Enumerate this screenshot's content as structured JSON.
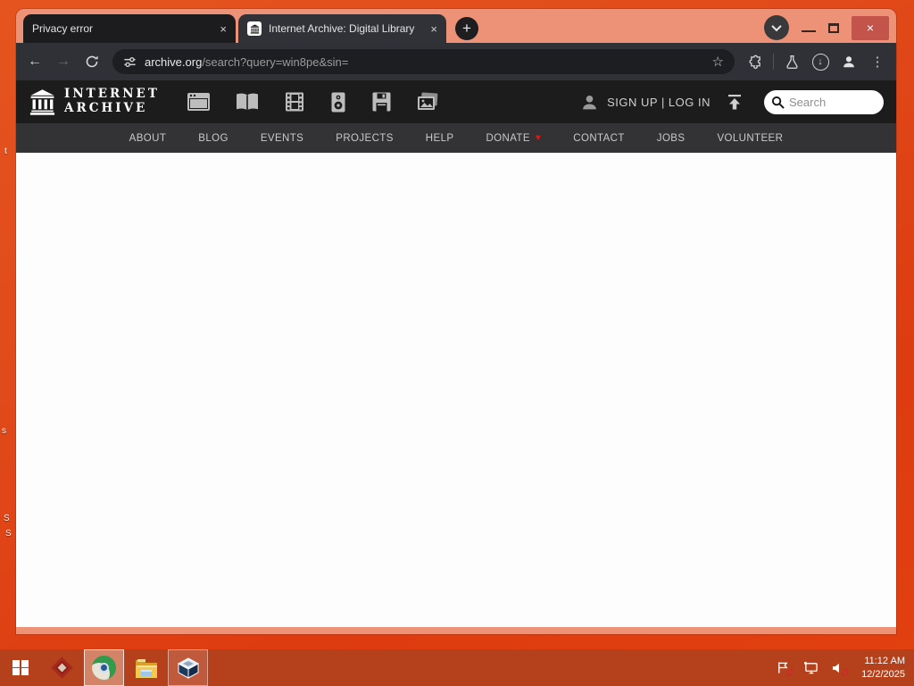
{
  "desktop": {
    "fragments": [
      "t",
      "s",
      "S",
      "S"
    ]
  },
  "browser": {
    "tabs": [
      {
        "title": "Privacy error",
        "close": "×"
      },
      {
        "title": "Internet Archive: Digital Library",
        "close": "×"
      }
    ],
    "new_tab_label": "+",
    "controls": {
      "close": "×"
    },
    "toolbar": {
      "back": "←",
      "forward": "→",
      "star": "☆",
      "download_arrow": "↓",
      "menu": "⋮"
    },
    "omnibox": {
      "domain": "archive.org",
      "path": "/search?query=win8pe&sin="
    }
  },
  "ia": {
    "logo_line1": "INTERNET",
    "logo_line2": "ARCHIVE",
    "auth": "SIGN UP | LOG IN",
    "search_placeholder": "Search",
    "nav": {
      "items": [
        {
          "label": "ABOUT"
        },
        {
          "label": "BLOG"
        },
        {
          "label": "EVENTS"
        },
        {
          "label": "PROJECTS"
        },
        {
          "label": "HELP"
        },
        {
          "label": "DONATE"
        },
        {
          "label": "CONTACT"
        },
        {
          "label": "JOBS"
        },
        {
          "label": "VOLUNTEER"
        }
      ],
      "donate_heart": "♥"
    }
  },
  "taskbar": {
    "time": "11:12 AM",
    "date": "12/2/2025"
  },
  "colors": {
    "desktop_red": "#dd3c10",
    "window_frame": "#ed9276",
    "taskbar": "#b5411c",
    "toolbar_dark": "#303136",
    "ia_header": "#1c1c1c",
    "close_button": "#c2544c",
    "donate_heart": "#e81414"
  }
}
